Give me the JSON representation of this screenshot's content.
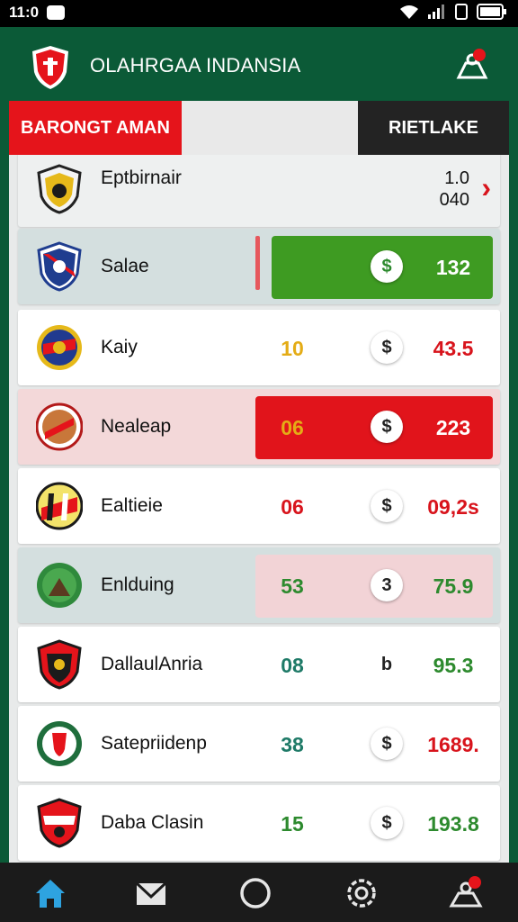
{
  "status": {
    "time": "11:0"
  },
  "header": {
    "title": "OLAHRGAA INDANSIA"
  },
  "tabs": {
    "left": "BARONGT AMAN",
    "right": "RIETLAKE"
  },
  "top_row": {
    "team": "Eptbirnair",
    "line1": "1.0",
    "line2": "040"
  },
  "rows": [
    {
      "team": "Salae",
      "score": "",
      "coin": "$",
      "value": "132"
    },
    {
      "team": "Kaiy",
      "score": "10",
      "coin": "$",
      "value": "43.5"
    },
    {
      "team": "Nealeap",
      "score": "06",
      "coin": "$",
      "value": "223"
    },
    {
      "team": "Ealtieie",
      "score": "06",
      "coin": "$",
      "value": "09,2s"
    },
    {
      "team": "Enlduing",
      "score": "53",
      "coin": "3",
      "value": "75.9"
    },
    {
      "team": "DallaulAnria",
      "score": "08",
      "coin": "b",
      "value": "95.3"
    },
    {
      "team": "Satepriidenp",
      "score": "38",
      "coin": "$",
      "value": "1689."
    },
    {
      "team": "Daba Clasin",
      "score": "15",
      "coin": "$",
      "value": "193.8"
    }
  ],
  "bottom_nav": [
    {
      "icon": "home-icon"
    },
    {
      "icon": "mail-icon"
    },
    {
      "icon": "circle-icon"
    },
    {
      "icon": "settings-icon"
    },
    {
      "icon": "profile-icon"
    }
  ],
  "colors": {
    "brand_green": "#0b5a37",
    "accent_red": "#e5141b",
    "highlight_green": "#3e9b22"
  }
}
